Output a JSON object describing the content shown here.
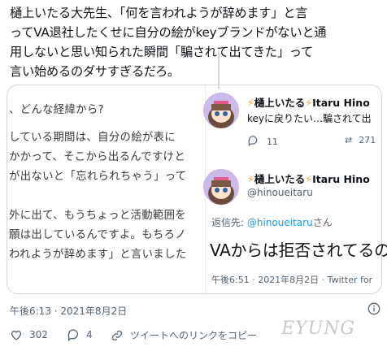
{
  "tweet": {
    "lines": [
      "樋上いたる大先生、「何を言われようが辞めます」と言",
      "ってVA退社したくせに自分の絵がkeyブランドがないと通",
      "用しないと思い知られた瞬間「騙されて出てきた」って",
      "言い始めるのダサすぎるだろ。"
    ],
    "timestamp": "午後6:13 · 2021年8月2日",
    "likes": "302",
    "replies": "4",
    "copy_link": "ツイートへのリンクをコピー"
  },
  "quoted_article": {
    "lines": [
      "、どんな経緯から?",
      "している期間は、自分の絵が表に",
      "かかって、そこから出るんですけと",
      "が出ないと「忘れられちゃう」って",
      "外に出て、もうちょっと活動範囲を",
      "願は出しているんですよ。もちろノ",
      "われようが辞めます」と言いました"
    ]
  },
  "right_tweets": {
    "first": {
      "display_name": "樋上いたる",
      "alt_name": "Itaru Hino",
      "text": "keyに戻りたい…騙されて出",
      "reply_count": "11",
      "retweet_count": "271"
    },
    "second": {
      "display_name": "樋上いたる",
      "alt_name": "Itaru Hino",
      "handle": "@hinoueitaru",
      "reply_label": "返信先:",
      "reply_handle": "@hinoueitaru",
      "reply_suffix": "さん",
      "text": "VAからは拒否されてるの",
      "time": "午後6:51 · 2021年8月2日 · Twitter for"
    }
  },
  "watermark": "EYUNG",
  "colors": {
    "accent": "#1d9bf0",
    "bolt": "#f5a623",
    "muted": "#536471"
  },
  "icons": [
    "heart-icon",
    "reply-icon",
    "link-icon",
    "info-icon",
    "retweet-icon",
    "lightning-icon"
  ]
}
